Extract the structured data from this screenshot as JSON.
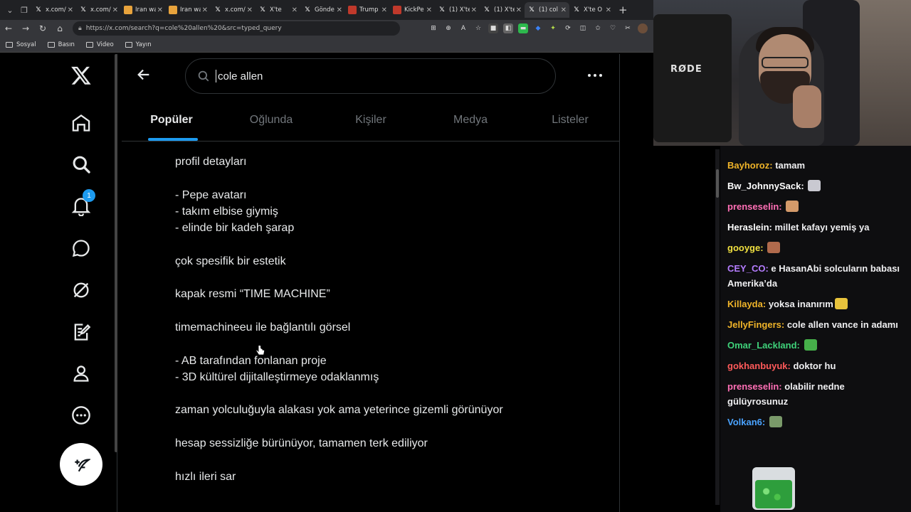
{
  "browser": {
    "tabs": [
      {
        "title": "x.com/i",
        "favicon": "x-logo",
        "active": false
      },
      {
        "title": "x.com/i",
        "favicon": "x-logo",
        "active": false
      },
      {
        "title": "Iran wa",
        "favicon": "orange-page",
        "active": false
      },
      {
        "title": "Iran wa",
        "favicon": "orange-page",
        "active": false
      },
      {
        "title": "x.com/i",
        "favicon": "x-logo",
        "active": false
      },
      {
        "title": "X'te",
        "favicon": "x-logo",
        "active": false
      },
      {
        "title": "Gönde",
        "favicon": "x-logo",
        "active": false
      },
      {
        "title": "Trump",
        "favicon": "red-page",
        "active": false
      },
      {
        "title": "KickPe",
        "favicon": "red-page",
        "active": false
      },
      {
        "title": "(1) X'te",
        "favicon": "x-logo",
        "active": false
      },
      {
        "title": "(1) X'te",
        "favicon": "x-logo",
        "active": false
      },
      {
        "title": "(1) col",
        "favicon": "x-logo",
        "active": true
      },
      {
        "title": "X'te O",
        "favicon": "x-logo",
        "active": false
      }
    ],
    "url": "https://x.com/search?q=cole%20allen%20&src=typed_query",
    "bookmarks": [
      "Sosyal",
      "Basın",
      "Video",
      "Yayın"
    ]
  },
  "x": {
    "search_query": "cole allen",
    "notification_count": "1",
    "tabs": [
      "Popüler",
      "Oğlunda",
      "Kişiler",
      "Medya",
      "Listeler"
    ],
    "post_lines": [
      "profil detayları",
      "",
      "- Pepe avatarı",
      "- takım elbise giymiş",
      "- elinde bir kadeh şarap",
      "",
      "çok spesifik bir estetik",
      "",
      "kapak resmi “TIME MACHINE”",
      "",
      "timemachineeu ile bağlantılı görsel",
      "",
      "- AB tarafından fonlanan proje",
      "- 3D kültürel dijitalleştirmeye odaklanmış",
      "",
      "zaman yolculuğuyla alakası yok ama yeterince gizemli görünüyor",
      "",
      "hesap sessizliğe bürünüyor, tamamen terk ediliyor",
      "",
      "hızlı ileri sar"
    ]
  },
  "stream": {
    "mic_brand": "RØDE",
    "chat": [
      {
        "user": "Bayhoroz",
        "color": "#f0b429",
        "text": "tamam",
        "emote": null
      },
      {
        "user": "Bw_JohnnySack",
        "color": "#ffffff",
        "text": "",
        "emote": "#c9c9d1"
      },
      {
        "user": "prenseselin",
        "color": "#ff6fb5",
        "text": "",
        "emote": "#d49a6a"
      },
      {
        "user": "Heraslein",
        "color": "#ffffff",
        "text": "millet kafayı yemiş ya",
        "emote": null
      },
      {
        "user": "gooyge",
        "color": "#f0e040",
        "text": "",
        "emote": "#b06a4c"
      },
      {
        "user": "CEY_CO",
        "color": "#b57dff",
        "text": "e HasanAbi solcuların babası Amerika’da",
        "emote": null
      },
      {
        "user": "Killayda",
        "color": "#f0b429",
        "text": "yoksa inanırım",
        "emote": "#e8c33c"
      },
      {
        "user": "JellyFingers",
        "color": "#f0b429",
        "text": "cole allen vance in adamı",
        "emote": null
      },
      {
        "user": "Omar_Lackland",
        "color": "#3fd27a",
        "text": "",
        "emote": "#46b04a"
      },
      {
        "user": "gokhanbuyuk",
        "color": "#ff5a5a",
        "text": "doktor hu",
        "emote": null
      },
      {
        "user": "prenseselin",
        "color": "#ff6fb5",
        "text": "olabilir nedne gülüyrosunuz",
        "emote": null
      },
      {
        "user": "Volkan6",
        "color": "#4aa3ff",
        "text": "",
        "emote": "#7a9a6a"
      }
    ]
  }
}
